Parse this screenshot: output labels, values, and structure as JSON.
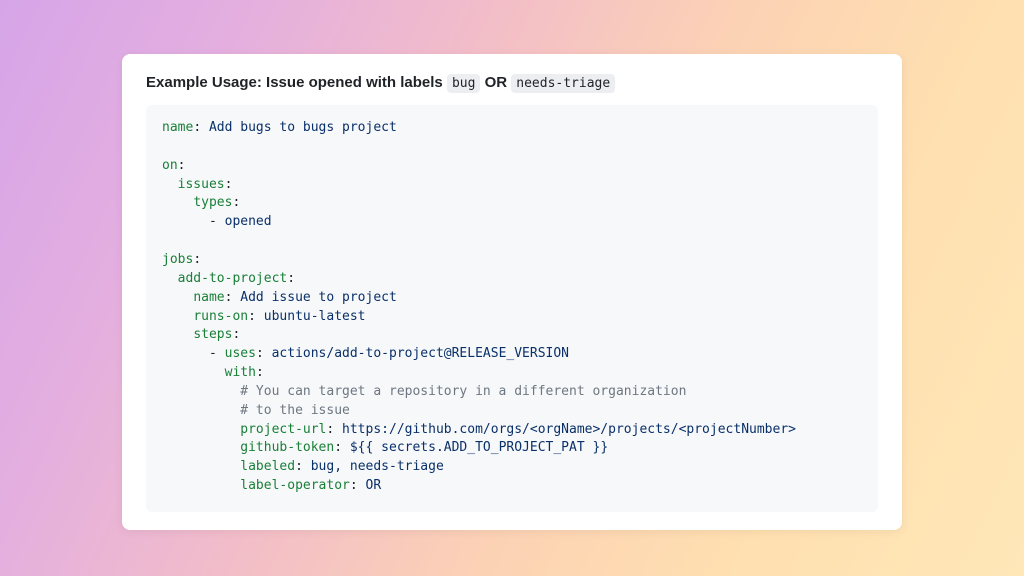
{
  "heading": {
    "prefix": "Example Usage: Issue opened with labels ",
    "code1": "bug",
    "mid": " OR ",
    "code2": "needs-triage"
  },
  "yaml": {
    "name_key": "name",
    "name_val": "Add bugs to bugs project",
    "on_key": "on",
    "issues_key": "issues",
    "types_key": "types",
    "types_item": "opened",
    "jobs_key": "jobs",
    "job_id": "add-to-project",
    "job_name_key": "name",
    "job_name_val": "Add issue to project",
    "runs_on_key": "runs-on",
    "runs_on_val": "ubuntu-latest",
    "steps_key": "steps",
    "uses_key": "uses",
    "uses_val": "actions/add-to-project@RELEASE_VERSION",
    "with_key": "with",
    "comment1": "# You can target a repository in a different organization",
    "comment2": "# to the issue",
    "project_url_key": "project-url",
    "project_url_val": "https://github.com/orgs/<orgName>/projects/<projectNumber>",
    "github_token_key": "github-token",
    "github_token_val": "${{ secrets.ADD_TO_PROJECT_PAT }}",
    "labeled_key": "labeled",
    "labeled_val": "bug, needs-triage",
    "label_operator_key": "label-operator",
    "label_operator_val": "OR"
  }
}
